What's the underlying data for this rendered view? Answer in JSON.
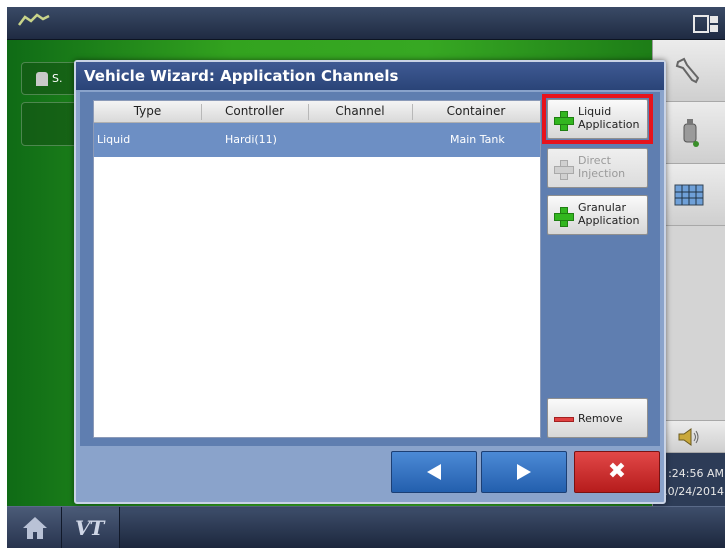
{
  "dialog": {
    "title": "Vehicle Wizard:  Application Channels",
    "table": {
      "headers": [
        "Type",
        "Controller",
        "Channel",
        "Container"
      ],
      "rows": [
        {
          "type": "Liquid",
          "controller": "Hardi(11)",
          "channel": "",
          "container": "Main Tank"
        }
      ]
    },
    "buttons": {
      "liquid_application": "Liquid\nApplication",
      "direct_injection": "Direct\nInjection",
      "granular_application": "Granular\nApplication",
      "remove": "Remove",
      "close_glyph": "✖"
    }
  },
  "background": {
    "card_label_fragment": "S.",
    "clock_time": ":24:56 AM",
    "clock_date": ".0/24/2014",
    "bottom_vt_label": "VT"
  },
  "colors": {
    "highlight": "#e6131c",
    "title_bar": "#2a4478",
    "selected_row": "#6d8fc4",
    "nav_button": "#2f6cbd",
    "close_button": "#c82626"
  },
  "icons": [
    "gps-icon",
    "display-icon",
    "wrench-icon",
    "sprayer-icon",
    "map-grid-icon",
    "horn-icon",
    "home-icon",
    "plus-icon",
    "minus-icon",
    "arrow-left-icon",
    "arrow-right-icon",
    "close-icon"
  ]
}
